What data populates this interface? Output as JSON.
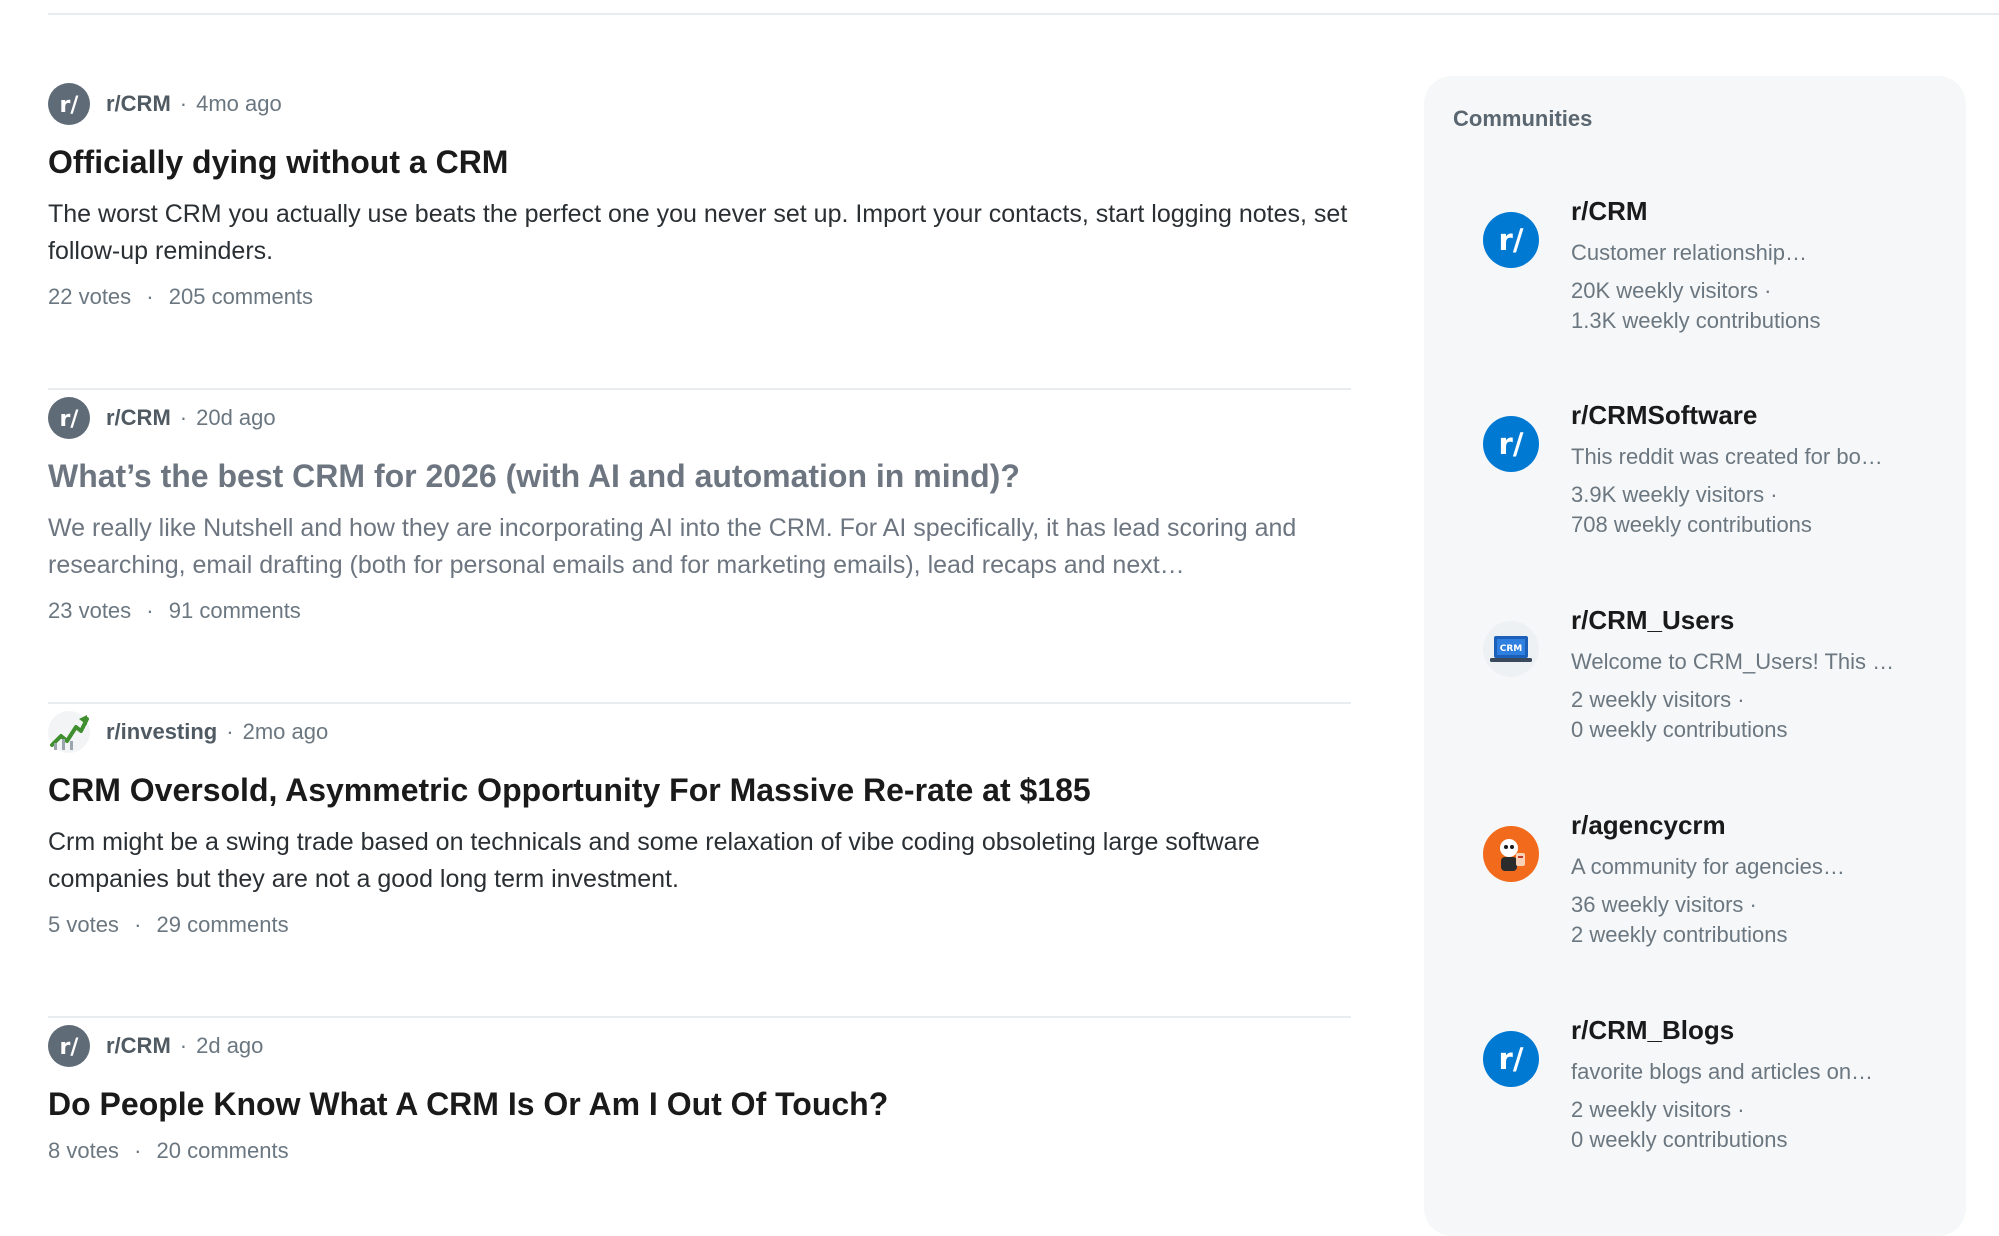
{
  "posts": [
    {
      "subreddit": "r/CRM",
      "time": "4mo ago",
      "avatar": "reddit-logo-icon",
      "title": "Officially dying without a CRM",
      "body": "The worst CRM you actually use beats the perfect one you never set up. Import your contacts, start logging notes, set follow-up reminders.",
      "votes": "22 votes",
      "comments": "205 comments",
      "visited": false
    },
    {
      "subreddit": "r/CRM",
      "time": "20d ago",
      "avatar": "reddit-logo-icon",
      "title": "What’s the best CRM for 2026 (with AI and automation in mind)?",
      "body": "We really like Nutshell and how they are incorporating AI into the CRM. For AI specifically, it has lead scoring and researching, email drafting (both for personal emails and for marketing emails), lead recaps and next…",
      "votes": "23 votes",
      "comments": "91 comments",
      "visited": true
    },
    {
      "subreddit": "r/investing",
      "time": "2mo ago",
      "avatar": "investing-chart-icon",
      "title": "CRM Oversold, Asymmetric Opportunity For Massive Re-rate at $185",
      "body": "Crm might be a swing trade based on technicals and some relaxation of vibe coding obsoleting large software companies but they are not a good long term investment.",
      "votes": "5 votes",
      "comments": "29 comments",
      "visited": false
    },
    {
      "subreddit": "r/CRM",
      "time": "2d ago",
      "avatar": "reddit-logo-icon",
      "title": "Do People Know What A CRM Is Or Am I Out Of Touch?",
      "body": "",
      "votes": "8 votes",
      "comments": "20 comments",
      "visited": false
    }
  ],
  "sidebar": {
    "heading": "Communities",
    "communities": [
      {
        "name": "r/CRM",
        "desc": "Customer relationship…",
        "visitors": "20K weekly visitors ·",
        "contributions": "1.3K weekly contributions",
        "icon": "reddit-logo-icon"
      },
      {
        "name": "r/CRMSoftware",
        "desc": "This reddit was created for bo…",
        "visitors": "3.9K weekly visitors ·",
        "contributions": "708 weekly contributions",
        "icon": "reddit-logo-icon"
      },
      {
        "name": "r/CRM_Users",
        "desc": "Welcome to CRM_Users! This …",
        "visitors": "2 weekly visitors ·",
        "contributions": "0 weekly contributions",
        "icon": "crm-laptop-icon",
        "icon_text": "CRM"
      },
      {
        "name": "r/agencycrm",
        "desc": "A community for agencies…",
        "visitors": "36 weekly visitors ·",
        "contributions": "2 weekly contributions",
        "icon": "agency-mascot-icon"
      },
      {
        "name": "r/CRM_Blogs",
        "desc": "favorite blogs and articles on…",
        "visitors": "2 weekly visitors ·",
        "contributions": "0 weekly contributions",
        "icon": "reddit-logo-icon"
      }
    ]
  },
  "colors": {
    "reddit_blue": "#0079d3",
    "avatar_gray": "#5f6b76",
    "agency_orange": "#f26a1b",
    "visited_text": "#6d7680"
  }
}
